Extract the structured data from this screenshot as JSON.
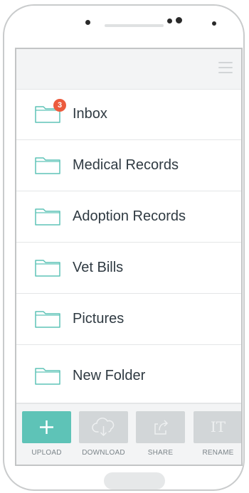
{
  "colors": {
    "accent": "#5ec3b7",
    "badge": "#ec5b3d",
    "folder_stroke": "#5ec3b7",
    "disabled_tile": "#d2d6d8"
  },
  "header": {
    "menu_icon": "hamburger-menu-icon"
  },
  "folders": [
    {
      "label": "Inbox",
      "badge": "3",
      "icon": "folder-icon"
    },
    {
      "label": "Medical Records",
      "icon": "folder-icon"
    },
    {
      "label": "Adoption Records",
      "icon": "folder-icon"
    },
    {
      "label": "Vet Bills",
      "icon": "folder-icon"
    },
    {
      "label": "Pictures",
      "icon": "folder-icon"
    },
    {
      "label": "New Folder",
      "icon": "folder-icon"
    }
  ],
  "actions": [
    {
      "label": "UPLOAD",
      "icon": "plus-icon",
      "enabled": true
    },
    {
      "label": "DOWNLOAD",
      "icon": "cloud-download-icon",
      "enabled": false
    },
    {
      "label": "SHARE",
      "icon": "share-icon",
      "enabled": false
    },
    {
      "label": "RENAME",
      "icon": "rename-text-icon",
      "glyph": "IT",
      "enabled": false
    }
  ]
}
